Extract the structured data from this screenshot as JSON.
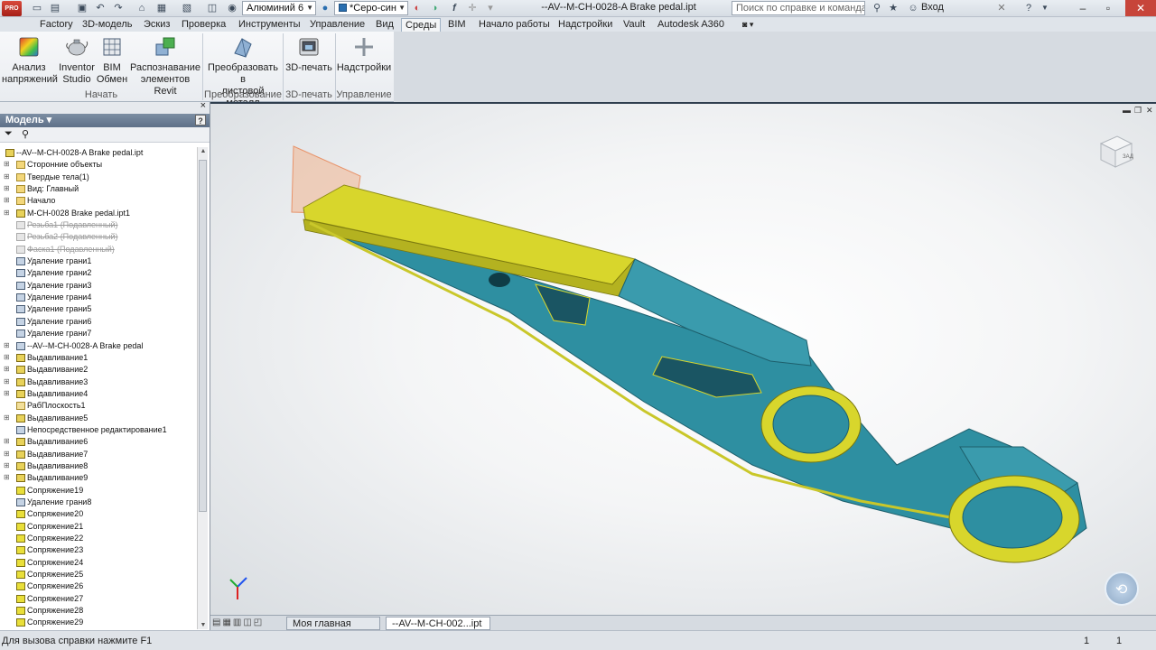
{
  "app": {
    "badge": "PRO"
  },
  "quick_access": {
    "material": "Алюминий 6",
    "appearance": "*Серо-син",
    "fx": "f"
  },
  "window": {
    "title": "--AV--M-CH-0028-A Brake pedal.ipt"
  },
  "search": {
    "placeholder": "Поиск по справке и командам"
  },
  "user": {
    "login": "Вход"
  },
  "menu": [
    {
      "label": "Factory"
    },
    {
      "label": "3D-модель"
    },
    {
      "label": "Эскиз"
    },
    {
      "label": "Проверка"
    },
    {
      "label": "Инструменты"
    },
    {
      "label": "Управление"
    },
    {
      "label": "Вид"
    },
    {
      "label": "Среды"
    },
    {
      "label": "BIM"
    },
    {
      "label": "Начало работы"
    },
    {
      "label": "Надстройки"
    },
    {
      "label": "Vault"
    },
    {
      "label": "Autodesk A360"
    }
  ],
  "ribbon": {
    "buttons": [
      {
        "line1": "Анализ",
        "line2": "напряжений"
      },
      {
        "line1": "Inventor",
        "line2": "Studio"
      },
      {
        "line1": "BIM",
        "line2": "Обмен"
      },
      {
        "line1": "Распознавание",
        "line2": "элементов Revit"
      },
      {
        "line1": "Преобразовать в",
        "line2": "листовой металл"
      },
      {
        "line1": "3D-печать",
        "line2": ""
      },
      {
        "line1": "Надстройки",
        "line2": ""
      }
    ],
    "groups": [
      "Начать",
      "Преобразование",
      "3D-печать",
      "Управление"
    ]
  },
  "browser": {
    "title": "Модель",
    "help": "?",
    "tree": [
      {
        "label": "--AV--M-CH-0028-A Brake pedal.ipt",
        "icon": "part",
        "root": true,
        "exp": false,
        "supp": false
      },
      {
        "label": "Сторонние объекты",
        "icon": "folder",
        "root": false,
        "exp": true,
        "supp": false
      },
      {
        "label": "Твердые тела(1)",
        "icon": "folder",
        "root": false,
        "exp": true,
        "supp": false
      },
      {
        "label": "Вид: Главный",
        "icon": "folder",
        "root": false,
        "exp": true,
        "supp": false
      },
      {
        "label": "Начало",
        "icon": "folder",
        "root": false,
        "exp": true,
        "supp": false
      },
      {
        "label": "M-CH-0028 Brake pedal.ipt1",
        "icon": "part",
        "root": false,
        "exp": true,
        "supp": false
      },
      {
        "label": "Резьба1 (Подавленный)",
        "icon": "supp",
        "root": false,
        "exp": false,
        "supp": true
      },
      {
        "label": "Резьба2 (Подавленный)",
        "icon": "supp",
        "root": false,
        "exp": false,
        "supp": true
      },
      {
        "label": "Фаска1 (Подавленный)",
        "icon": "supp",
        "root": false,
        "exp": false,
        "supp": true
      },
      {
        "label": "Удаление грани1",
        "icon": "face",
        "root": false,
        "exp": false,
        "supp": false
      },
      {
        "label": "Удаление грани2",
        "icon": "face",
        "root": false,
        "exp": false,
        "supp": false
      },
      {
        "label": "Удаление грани3",
        "icon": "face",
        "root": false,
        "exp": false,
        "supp": false
      },
      {
        "label": "Удаление грани4",
        "icon": "face",
        "root": false,
        "exp": false,
        "supp": false
      },
      {
        "label": "Удаление грани5",
        "icon": "face",
        "root": false,
        "exp": false,
        "supp": false
      },
      {
        "label": "Удаление грани6",
        "icon": "face",
        "root": false,
        "exp": false,
        "supp": false
      },
      {
        "label": "Удаление грани7",
        "icon": "face",
        "root": false,
        "exp": false,
        "supp": false
      },
      {
        "label": "--AV--M-CH-0028-A Brake pedal",
        "icon": "face",
        "root": false,
        "exp": true,
        "supp": false
      },
      {
        "label": "Выдавливание1",
        "icon": "part",
        "root": false,
        "exp": true,
        "supp": false
      },
      {
        "label": "Выдавливание2",
        "icon": "part",
        "root": false,
        "exp": true,
        "supp": false
      },
      {
        "label": "Выдавливание3",
        "icon": "part",
        "root": false,
        "exp": true,
        "supp": false
      },
      {
        "label": "Выдавливание4",
        "icon": "part",
        "root": false,
        "exp": true,
        "supp": false
      },
      {
        "label": "РабПлоскость1",
        "icon": "plane",
        "root": false,
        "exp": false,
        "supp": false
      },
      {
        "label": "Выдавливание5",
        "icon": "part",
        "root": false,
        "exp": true,
        "supp": false
      },
      {
        "label": "Непосредственное редактирование1",
        "icon": "face",
        "root": false,
        "exp": false,
        "supp": false
      },
      {
        "label": "Выдавливание6",
        "icon": "part",
        "root": false,
        "exp": true,
        "supp": false
      },
      {
        "label": "Выдавливание7",
        "icon": "part",
        "root": false,
        "exp": true,
        "supp": false
      },
      {
        "label": "Выдавливание8",
        "icon": "part",
        "root": false,
        "exp": true,
        "supp": false
      },
      {
        "label": "Выдавливание9",
        "icon": "part",
        "root": false,
        "exp": true,
        "supp": false
      },
      {
        "label": "Сопряжение19",
        "icon": "fillet",
        "root": false,
        "exp": false,
        "supp": false
      },
      {
        "label": "Удаление грани8",
        "icon": "face",
        "root": false,
        "exp": false,
        "supp": false
      },
      {
        "label": "Сопряжение20",
        "icon": "fillet",
        "root": false,
        "exp": false,
        "supp": false
      },
      {
        "label": "Сопряжение21",
        "icon": "fillet",
        "root": false,
        "exp": false,
        "supp": false
      },
      {
        "label": "Сопряжение22",
        "icon": "fillet",
        "root": false,
        "exp": false,
        "supp": false
      },
      {
        "label": "Сопряжение23",
        "icon": "fillet",
        "root": false,
        "exp": false,
        "supp": false
      },
      {
        "label": "Сопряжение24",
        "icon": "fillet",
        "root": false,
        "exp": false,
        "supp": false
      },
      {
        "label": "Сопряжение25",
        "icon": "fillet",
        "root": false,
        "exp": false,
        "supp": false
      },
      {
        "label": "Сопряжение26",
        "icon": "fillet",
        "root": false,
        "exp": false,
        "supp": false
      },
      {
        "label": "Сопряжение27",
        "icon": "fillet",
        "root": false,
        "exp": false,
        "supp": false
      },
      {
        "label": "Сопряжение28",
        "icon": "fillet",
        "root": false,
        "exp": false,
        "supp": false
      },
      {
        "label": "Сопряжение29",
        "icon": "fillet",
        "root": false,
        "exp": false,
        "supp": false
      }
    ]
  },
  "viewport": {
    "view_label": "ЗАД"
  },
  "doc_tabs": [
    {
      "label": "Моя главная стран..."
    },
    {
      "label": "--AV--M-CH-002...ipt"
    }
  ],
  "status": {
    "hint": "Для вызова справки нажмите F1",
    "n1": "1",
    "n2": "1"
  },
  "colors": {
    "model_yellow": "#d8d62c",
    "model_teal": "#2e8fa1",
    "accent_blue": "#2a6fb0"
  }
}
